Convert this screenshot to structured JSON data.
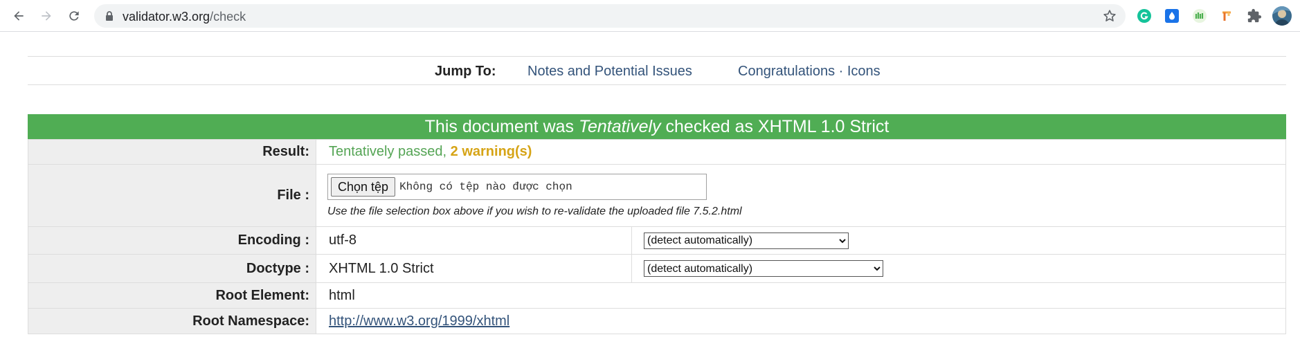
{
  "browser": {
    "url_host": "validator.w3.org",
    "url_path": "/check"
  },
  "jump": {
    "label": "Jump To:",
    "link1": "Notes and Potential Issues",
    "link2": "Congratulations · Icons"
  },
  "result_header": {
    "prefix": "This document was ",
    "emphasis": "Tentatively",
    "suffix": " checked as XHTML 1.0 Strict",
    "color": "#50ad54"
  },
  "rows": {
    "result": {
      "label": "Result:",
      "passed": "Tentatively passed, ",
      "warnings": "2 warning(s)"
    },
    "file": {
      "label": "File :",
      "button": "Chọn tệp",
      "none_chosen": "Không có tệp nào được chọn",
      "note": "Use the file selection box above if you wish to re-validate the uploaded file 7.5.2.html"
    },
    "encoding": {
      "label": "Encoding :",
      "value": "utf-8",
      "select": "(detect automatically)"
    },
    "doctype": {
      "label": "Doctype :",
      "value": "XHTML 1.0 Strict",
      "select": "(detect automatically)"
    },
    "root_element": {
      "label": "Root Element:",
      "value": "html"
    },
    "root_namespace": {
      "label": "Root Namespace:",
      "value": "http://www.w3.org/1999/xhtml"
    }
  },
  "icons": [
    "back-icon",
    "forward-icon",
    "reload-icon",
    "lock-icon",
    "star-icon",
    "grammarly-icon",
    "dropbox-drop-icon",
    "green-extension-icon",
    "orange-extension-icon",
    "puzzle-icon",
    "profile-avatar"
  ]
}
